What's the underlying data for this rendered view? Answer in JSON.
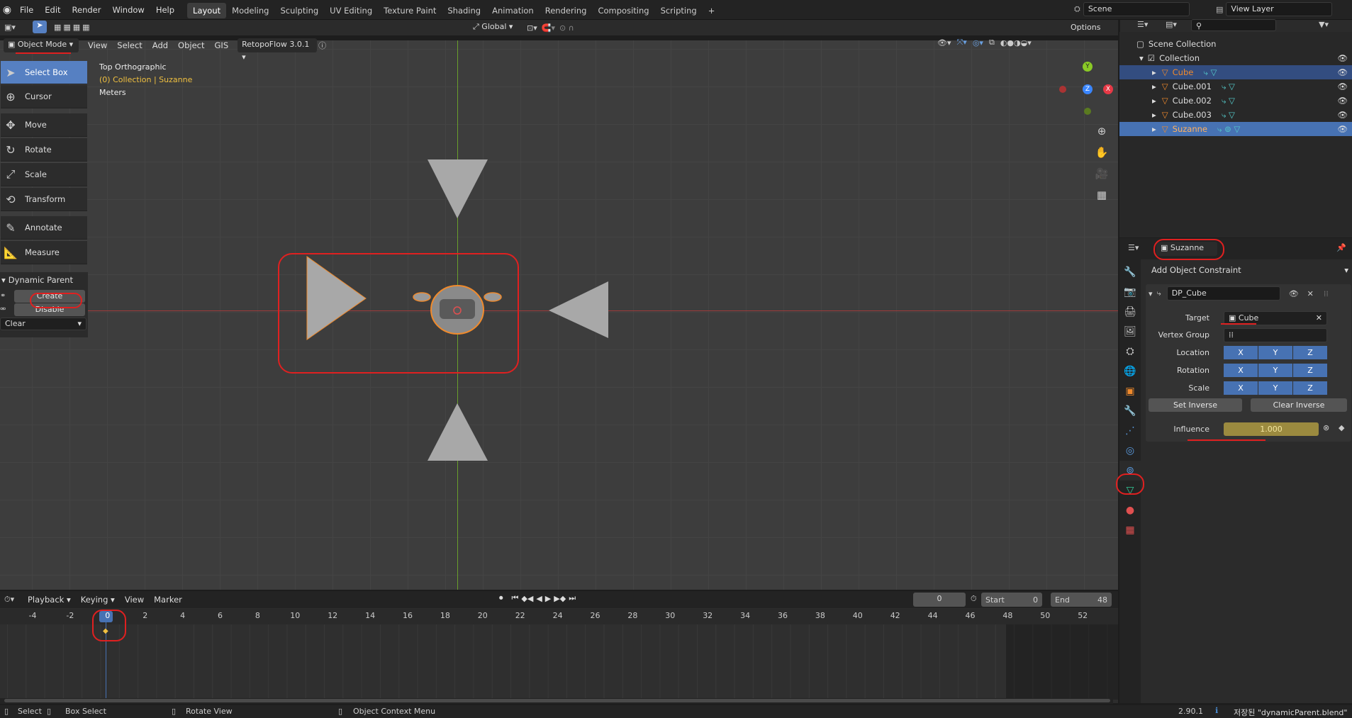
{
  "topbar": {
    "menus": [
      "File",
      "Edit",
      "Render",
      "Window",
      "Help"
    ],
    "workspaces": [
      "Layout",
      "Modeling",
      "Sculpting",
      "UV Editing",
      "Texture Paint",
      "Shading",
      "Animation",
      "Rendering",
      "Compositing",
      "Scripting"
    ],
    "scene": "Scene",
    "view_layer": "View Layer"
  },
  "viewport_header": {
    "mode": "Object Mode",
    "menus": [
      "View",
      "Select",
      "Add",
      "Object",
      "GIS"
    ],
    "retopoflow": "RetopoFlow 3.0.1",
    "transform_orientation": "Global",
    "options": "Options"
  },
  "overlay": {
    "view_name": "Top Orthographic",
    "collection": "(0) Collection | Suzanne",
    "units": "Meters"
  },
  "toolbar": {
    "tools": [
      "Select Box",
      "Cursor",
      "Move",
      "Rotate",
      "Scale",
      "Transform",
      "Annotate",
      "Measure"
    ]
  },
  "dynamic_parent": {
    "title": "Dynamic Parent",
    "create": "Create",
    "disable": "Disable",
    "clear": "Clear"
  },
  "outliner": {
    "root": "Scene Collection",
    "collection": "Collection",
    "objects": [
      "Cube",
      "Cube.001",
      "Cube.002",
      "Cube.003",
      "Suzanne"
    ]
  },
  "properties": {
    "object_name": "Suzanne",
    "add_constraint": "Add Object Constraint",
    "constraint_name": "DP_Cube",
    "target_label": "Target",
    "target_value": "Cube",
    "vertex_group_label": "Vertex Group",
    "location_label": "Location",
    "rotation_label": "Rotation",
    "scale_label": "Scale",
    "axes": [
      "X",
      "Y",
      "Z"
    ],
    "set_inverse": "Set Inverse",
    "clear_inverse": "Clear Inverse",
    "influence_label": "Influence",
    "influence_value": "1.000"
  },
  "timeline": {
    "menus": [
      "Playback",
      "Keying",
      "View",
      "Marker"
    ],
    "current_frame": "0",
    "start_label": "Start",
    "start_value": "0",
    "end_label": "End",
    "end_value": "48",
    "ticks": [
      "-4",
      "-2",
      "0",
      "2",
      "4",
      "6",
      "8",
      "10",
      "12",
      "14",
      "16",
      "18",
      "20",
      "22",
      "24",
      "26",
      "28",
      "30",
      "32",
      "34",
      "36",
      "38",
      "40",
      "42",
      "44",
      "46",
      "48",
      "50",
      "52"
    ]
  },
  "statusbar": {
    "select": "Select",
    "box_select": "Box Select",
    "rotate_view": "Rotate View",
    "context_menu": "Object Context Menu",
    "version": "2.90.1",
    "saved": "저장된 \"dynamicParent.blend\""
  },
  "colors": {
    "accent": "#4772b3",
    "selected_orange": "#f08a2c",
    "annotation_red": "#e02020",
    "x_axis": "#9e3b3b",
    "y_axis": "#6a9e2c"
  }
}
